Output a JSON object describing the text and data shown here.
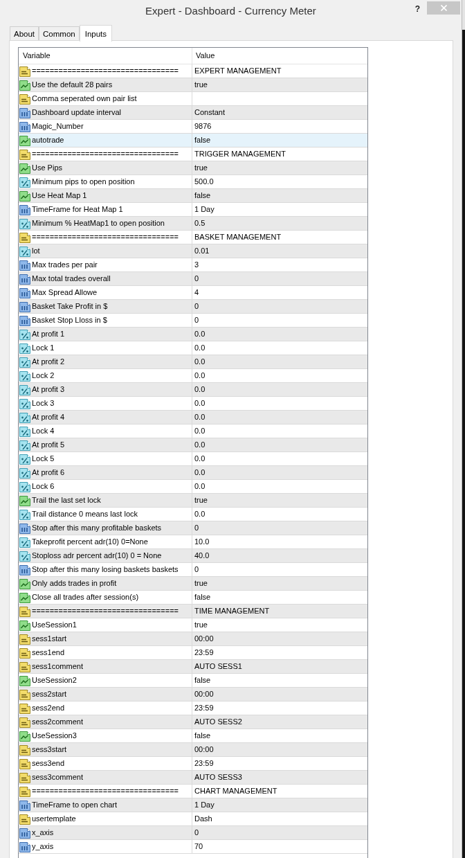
{
  "window": {
    "title": "Expert - Dashboard - Currency Meter",
    "help": "?"
  },
  "tabs": [
    {
      "label": "About",
      "selected": false
    },
    {
      "label": "Common",
      "selected": false
    },
    {
      "label": "Inputs",
      "selected": true
    }
  ],
  "table": {
    "columns": [
      "Variable",
      "Value"
    ],
    "rows": [
      {
        "kind": "string",
        "variable": "=================================",
        "value": "EXPERT MANAGEMENT",
        "selected": false
      },
      {
        "kind": "bool",
        "variable": "Use the default 28 pairs",
        "value": "true",
        "selected": false
      },
      {
        "kind": "string",
        "variable": "Comma seperated own pair list",
        "selected": false
      },
      {
        "kind": "int",
        "variable": "Dashboard update interval",
        "value": "Constant",
        "selected": false
      },
      {
        "kind": "int",
        "variable": "Magic_Number",
        "value": "9876",
        "selected": false
      },
      {
        "kind": "bool",
        "variable": "autotrade",
        "value": "false",
        "selected": true
      },
      {
        "kind": "string",
        "variable": "=================================",
        "value": "TRIGGER MANAGEMENT",
        "selected": false
      },
      {
        "kind": "bool",
        "variable": "Use Pips",
        "value": "true",
        "selected": false
      },
      {
        "kind": "double",
        "variable": "Minimum pips to open position",
        "value": "500.0",
        "selected": false
      },
      {
        "kind": "bool",
        "variable": "Use Heat Map 1",
        "value": "false",
        "selected": false
      },
      {
        "kind": "int",
        "variable": "TimeFrame for Heat Map 1",
        "value": "1 Day",
        "selected": false
      },
      {
        "kind": "double",
        "variable": "Minimum % HeatMap1 to open position",
        "value": "0.5",
        "selected": false
      },
      {
        "kind": "string",
        "variable": "=================================",
        "value": "BASKET MANAGEMENT",
        "selected": false
      },
      {
        "kind": "double",
        "variable": "lot",
        "value": "0.01",
        "selected": false
      },
      {
        "kind": "int",
        "variable": "Max trades per pair",
        "value": "3",
        "selected": false
      },
      {
        "kind": "int",
        "variable": "Max total trades overall",
        "value": "0",
        "selected": false
      },
      {
        "kind": "int",
        "variable": "Max Spread Allowe",
        "value": "4",
        "selected": false
      },
      {
        "kind": "int",
        "variable": "Basket Take Profit in $",
        "value": "0",
        "selected": false
      },
      {
        "kind": "int",
        "variable": "Basket Stop Lloss in $",
        "value": "0",
        "selected": false
      },
      {
        "kind": "double",
        "variable": "At profit 1",
        "value": "0.0",
        "selected": false
      },
      {
        "kind": "double",
        "variable": "Lock 1",
        "value": "0.0",
        "selected": false
      },
      {
        "kind": "double",
        "variable": "At profit 2",
        "value": "0.0",
        "selected": false
      },
      {
        "kind": "double",
        "variable": "Lock 2",
        "value": "0.0",
        "selected": false
      },
      {
        "kind": "double",
        "variable": "At profit 3",
        "value": "0.0",
        "selected": false
      },
      {
        "kind": "double",
        "variable": "Lock 3",
        "value": "0.0",
        "selected": false
      },
      {
        "kind": "double",
        "variable": "At profit 4",
        "value": "0.0",
        "selected": false
      },
      {
        "kind": "double",
        "variable": "Lock 4",
        "value": "0.0",
        "selected": false
      },
      {
        "kind": "double",
        "variable": "At profit 5",
        "value": "0.0",
        "selected": false
      },
      {
        "kind": "double",
        "variable": "Lock 5",
        "value": "0.0",
        "selected": false
      },
      {
        "kind": "double",
        "variable": "At profit 6",
        "value": "0.0",
        "selected": false
      },
      {
        "kind": "double",
        "variable": "Lock 6",
        "value": "0.0",
        "selected": false
      },
      {
        "kind": "bool",
        "variable": "Trail the last set lock",
        "value": "true",
        "selected": false
      },
      {
        "kind": "double",
        "variable": "Trail distance 0 means last lock",
        "value": "0.0",
        "selected": false
      },
      {
        "kind": "int",
        "variable": "Stop after this many profitable baskets",
        "value": "0",
        "selected": false
      },
      {
        "kind": "double",
        "variable": "Takeprofit percent adr(10) 0=None",
        "value": "10.0",
        "selected": false
      },
      {
        "kind": "double",
        "variable": "Stoploss adr percent adr(10) 0 = None",
        "value": "40.0",
        "selected": false
      },
      {
        "kind": "int",
        "variable": "Stop after this many losing baskets baskets",
        "value": "0",
        "selected": false
      },
      {
        "kind": "bool",
        "variable": "Only adds trades in profit",
        "value": "true",
        "selected": false
      },
      {
        "kind": "bool",
        "variable": "Close all trades after session(s)",
        "value": "false",
        "selected": false
      },
      {
        "kind": "string",
        "variable": "=================================",
        "value": "TIME MANAGEMENT",
        "selected": false
      },
      {
        "kind": "bool",
        "variable": "UseSession1",
        "value": "true",
        "selected": false
      },
      {
        "kind": "string",
        "variable": "sess1start",
        "value": "00:00",
        "selected": false
      },
      {
        "kind": "string",
        "variable": "sess1end",
        "value": "23:59",
        "selected": false
      },
      {
        "kind": "string",
        "variable": "sess1comment",
        "value": "AUTO SESS1",
        "selected": false
      },
      {
        "kind": "bool",
        "variable": "UseSession2",
        "value": "false",
        "selected": false
      },
      {
        "kind": "string",
        "variable": "sess2start",
        "value": "00:00",
        "selected": false
      },
      {
        "kind": "string",
        "variable": "sess2end",
        "value": "23:59",
        "selected": false
      },
      {
        "kind": "string",
        "variable": "sess2comment",
        "value": "AUTO SESS2",
        "selected": false
      },
      {
        "kind": "bool",
        "variable": "UseSession3",
        "value": "false",
        "selected": false
      },
      {
        "kind": "string",
        "variable": "sess3start",
        "value": "00:00",
        "selected": false
      },
      {
        "kind": "string",
        "variable": "sess3end",
        "value": "23:59",
        "selected": false
      },
      {
        "kind": "string",
        "variable": "sess3comment",
        "value": "AUTO SESS3",
        "selected": false
      },
      {
        "kind": "string",
        "variable": "=================================",
        "value": "CHART MANAGEMENT",
        "selected": false
      },
      {
        "kind": "int",
        "variable": "TimeFrame to open chart",
        "value": "1 Day",
        "selected": false
      },
      {
        "kind": "string",
        "variable": "usertemplate",
        "value": "Dash",
        "selected": false
      },
      {
        "kind": "int",
        "variable": "x_axis",
        "value": "0",
        "selected": false
      },
      {
        "kind": "int",
        "variable": "y_axis",
        "value": "70",
        "selected": false
      }
    ]
  }
}
